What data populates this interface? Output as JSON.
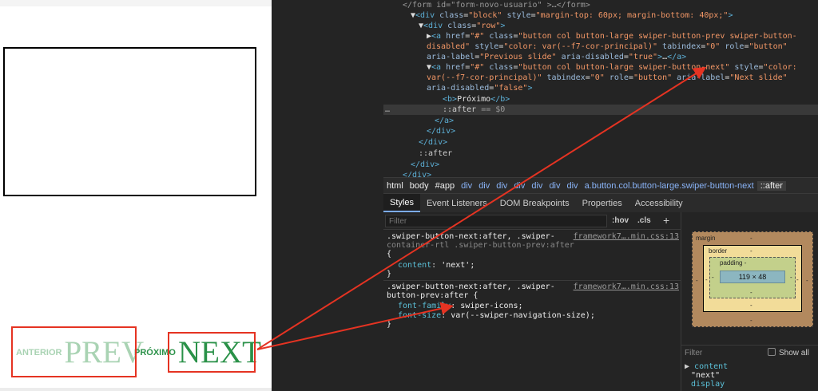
{
  "preview": {
    "prev_label": "ANTERIOR",
    "prev_after": "PREV",
    "next_label": "PRÓXIMO",
    "next_after": "NEXT"
  },
  "elements": {
    "lines": [
      {
        "indent": 0,
        "html": "<span class='dim'>&lt;/form id=\"form-novo-usuario\" &gt;…&lt;/form&gt;</span>"
      },
      {
        "indent": 1,
        "html": "▼<span class='tag'>&lt;div</span> <span class='attr'>class</span>=<span class='val'>\"block\"</span> <span class='attr'>style</span>=<span class='val'>\"margin-top: 60px; margin-bottom: 40px;\"</span><span class='tag'>&gt;</span>"
      },
      {
        "indent": 2,
        "html": "▼<span class='tag'>&lt;div</span> <span class='attr'>class</span>=<span class='val'>\"row\"</span><span class='tag'>&gt;</span>"
      },
      {
        "indent": 3,
        "html": "▶<span class='tag'>&lt;a</span> <span class='attr'>href</span>=<span class='val'>\"#\"</span> <span class='attr'>class</span>=<span class='val'>\"button col button-large swiper-button-prev swiper-button-</span>"
      },
      {
        "indent": 3,
        "html": "<span class='val'>disabled\"</span> <span class='attr'>style</span>=<span class='val'>\"color: var(--f7-cor-principal)\"</span> <span class='attr'>tabindex</span>=<span class='val'>\"0\"</span> <span class='attr'>role</span>=<span class='val'>\"button\"</span>"
      },
      {
        "indent": 3,
        "html": "<span class='attr'>aria-label</span>=<span class='val'>\"Previous slide\"</span> <span class='attr'>aria-disabled</span>=<span class='val'>\"true\"</span><span class='tag'>&gt;</span>…<span class='tag'>&lt;/a&gt;</span>"
      },
      {
        "indent": 3,
        "html": "▼<span class='tag'>&lt;a</span> <span class='attr'>href</span>=<span class='val'>\"#\"</span> <span class='attr'>class</span>=<span class='val'>\"button col button-large swiper-button-next\"</span> <span class='attr'>style</span>=<span class='val'>\"color:</span>"
      },
      {
        "indent": 3,
        "html": "<span class='val'>var(--f7-cor-principal)\"</span> <span class='attr'>tabindex</span>=<span class='val'>\"0\"</span> <span class='attr'>role</span>=<span class='val'>\"button\"</span> <span class='attr'>aria-label</span>=<span class='val'>\"Next slide\"</span>"
      },
      {
        "indent": 3,
        "html": "<span class='attr'>aria-disabled</span>=<span class='val'>\"false\"</span><span class='tag'>&gt;</span>"
      },
      {
        "indent": 5,
        "html": "<span class='tag'>&lt;b&gt;</span><span class='txt'>Próximo</span><span class='tag'>&lt;/b&gt;</span>"
      },
      {
        "indent": 5,
        "html": "<span class='pseudo'>::after</span> <span class='dim'>== $0</span>"
      },
      {
        "indent": 4,
        "html": "<span class='tag'>&lt;/a&gt;</span>"
      },
      {
        "indent": 3,
        "html": "<span class='tag'>&lt;/div&gt;</span>"
      },
      {
        "indent": 2,
        "html": "<span class='tag'>&lt;/div&gt;</span>"
      },
      {
        "indent": 2,
        "html": "<span class='pseudo'>::after</span>"
      },
      {
        "indent": 1,
        "html": "<span class='tag'>&lt;/div&gt;</span>"
      },
      {
        "indent": 0,
        "html": "<span class='tag'>&lt;/div&gt;</span>"
      }
    ]
  },
  "breadcrumbs": [
    "html",
    "body",
    "#app",
    "div",
    "div",
    "div",
    "div",
    "div",
    "div",
    "div",
    "a.button.col.button-large.swiper-button-next",
    "::after"
  ],
  "tabs": [
    "Styles",
    "Event Listeners",
    "DOM Breakpoints",
    "Properties",
    "Accessibility"
  ],
  "styles": {
    "filter_placeholder": "Filter",
    "hov": ":hov",
    "cls": ".cls",
    "plus": "+",
    "rule1": {
      "selector_line1": ".swiper-button-next:after, .swiper-",
      "selector_line2": "container-rtl .swiper-button-prev:after",
      "open": "{",
      "prop": "content",
      "value": "'next';",
      "close": "}",
      "source": "framework7….min.css:13"
    },
    "rule2": {
      "selector_line1": ".swiper-button-next:after, .swiper-",
      "selector_line2": "button-prev:after {",
      "prop1": "font-family",
      "value1": "swiper-icons;",
      "prop2": "font-size",
      "value2": "var(--swiper-navigation-size);",
      "close": "}",
      "source": "framework7….min.css:13"
    }
  },
  "boxmodel": {
    "margin": "margin",
    "margin_val": "-",
    "border": "border",
    "border_val": "-",
    "padding": "padding -",
    "content": "119 × 48",
    "dash": "-"
  },
  "computed": {
    "filter_placeholder": "Filter",
    "show_all": "Show all",
    "prop": "content",
    "value": "\"next\"",
    "prop2": "display"
  },
  "colors": {
    "annotation": "#e53322",
    "next_color": "#2a9148",
    "prev_color": "#a9d3b3"
  }
}
